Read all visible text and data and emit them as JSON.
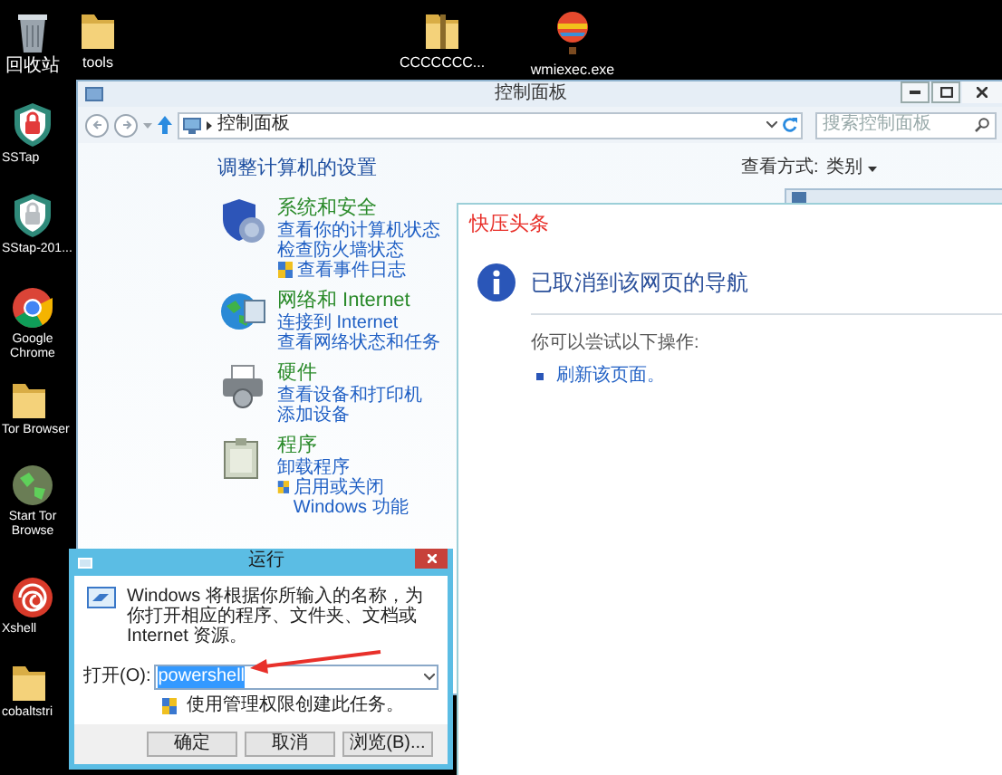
{
  "desktop_icons": [
    {
      "label": "回收站",
      "kind": "recycle"
    },
    {
      "label": "tools",
      "kind": "folder"
    },
    {
      "label": "CCCCCCC...",
      "kind": "zip"
    },
    {
      "label": "wmiexec.exe",
      "kind": "balloon"
    },
    {
      "label": "SSTap",
      "kind": "shield_red"
    },
    {
      "label": "SStap-201...",
      "kind": "shield_grey"
    },
    {
      "label": "Google Chrome",
      "kind": "ring"
    },
    {
      "label": "Tor Browser",
      "kind": "folder"
    },
    {
      "label": "Start Tor Browse",
      "kind": "globe"
    },
    {
      "label": "Xshell",
      "kind": "spiral"
    },
    {
      "label": "cobaltstri",
      "kind": "folder"
    }
  ],
  "control_panel": {
    "title": "控制面板",
    "address": "控制面板",
    "search_placeholder": "搜索控制面板",
    "heading": "调整计算机的设置",
    "view_label": "查看方式:",
    "view_value": "类别",
    "categories": [
      {
        "title": "系统和安全",
        "kind": "security",
        "links": [
          {
            "text": "查看你的计算机状态",
            "shield": false
          },
          {
            "text": "检查防火墙状态",
            "shield": false
          },
          {
            "text": "查看事件日志",
            "shield": true
          }
        ]
      },
      {
        "title": "网络和 Internet",
        "kind": "network",
        "links": [
          {
            "text": "连接到 Internet",
            "shield": false
          },
          {
            "text": "查看网络状态和任务",
            "shield": false
          }
        ]
      },
      {
        "title": "硬件",
        "kind": "hardware",
        "links": [
          {
            "text": "查看设备和打印机",
            "shield": false
          },
          {
            "text": "添加设备",
            "shield": false
          }
        ]
      },
      {
        "title": "程序",
        "kind": "programs",
        "links": [
          {
            "text": "卸载程序",
            "shield": false
          },
          {
            "text": "启用或关闭 Windows 功能",
            "shield": true
          }
        ]
      }
    ]
  },
  "popup": {
    "brand": "快压头条",
    "message": "已取消到该网页的导航",
    "hint": "你可以尝试以下操作:",
    "actions": [
      "刷新该页面。"
    ]
  },
  "run_dialog": {
    "title": "运行",
    "description": "Windows 将根据你所输入的名称，为你打开相应的程序、文件夹、文档或 Internet 资源。",
    "open_label": "打开(O):",
    "value": "powershell",
    "value_selected": true,
    "admin_note": "使用管理权限创建此任务。",
    "buttons": [
      "确定",
      "取消",
      "浏览(B)..."
    ]
  }
}
